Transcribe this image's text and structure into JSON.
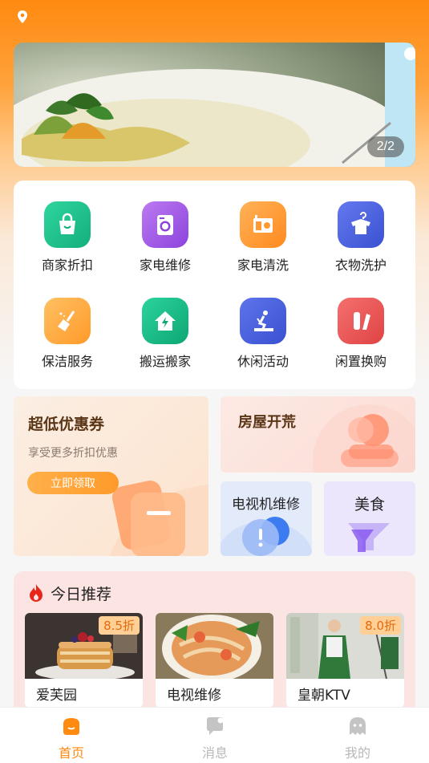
{
  "banner": {
    "counter": "2/2"
  },
  "services": [
    {
      "label": "商家折扣",
      "icon": "shopping-bag-icon",
      "color": "#1fc08e"
    },
    {
      "label": "家电维修",
      "icon": "washing-machine-icon",
      "color": "#a45be8"
    },
    {
      "label": "家电清洗",
      "icon": "appliance-icon",
      "color": "#ff9a32"
    },
    {
      "label": "衣物洗护",
      "icon": "shirt-hanger-icon",
      "color": "#4b63e0"
    },
    {
      "label": "保洁服务",
      "icon": "broom-icon",
      "color": "#ffa73a"
    },
    {
      "label": "搬运搬家",
      "icon": "house-arrow-icon",
      "color": "#19b985"
    },
    {
      "label": "休闲活动",
      "icon": "activity-icon",
      "color": "#4b63e0"
    },
    {
      "label": "闲置换购",
      "icon": "exchange-icon",
      "color": "#ef5757"
    }
  ],
  "coupon": {
    "title": "超低优惠券",
    "subtitle": "享受更多折扣优惠",
    "button": "立即领取"
  },
  "house": {
    "title": "房屋开荒"
  },
  "tv": {
    "title": "电视机维修"
  },
  "food": {
    "title": "美食"
  },
  "recommend": {
    "title": "今日推荐",
    "items": [
      {
        "name": "爱芙园",
        "discount": "8.5折"
      },
      {
        "name": "电视维修",
        "discount": ""
      },
      {
        "name": "皇朝KTV",
        "discount": "8.0折"
      }
    ]
  },
  "tabs": [
    {
      "label": "首页",
      "icon": "home-icon",
      "active": true
    },
    {
      "label": "消息",
      "icon": "message-icon",
      "active": false
    },
    {
      "label": "我的",
      "icon": "profile-ghost-icon",
      "active": false
    }
  ],
  "colors": {
    "accent": "#ff8a10",
    "tab_active": "#ff8a10",
    "tab_inactive": "#b8b8b8"
  }
}
